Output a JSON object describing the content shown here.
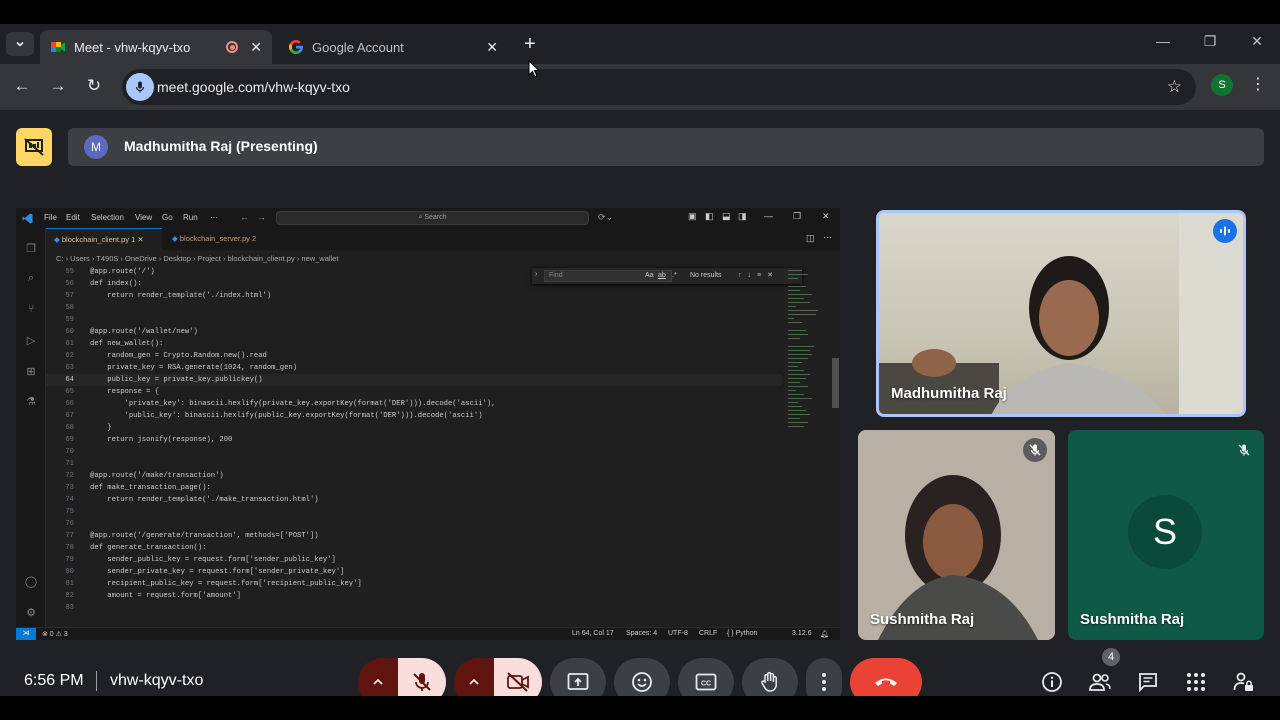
{
  "browser": {
    "tabs": [
      {
        "title": "Meet - vhw-kqyv-txo",
        "active": true
      },
      {
        "title": "Google Account",
        "active": false
      }
    ],
    "url": "meet.google.com/vhw-kqyv-txo",
    "profile_initial": "S"
  },
  "meet": {
    "presenter_initial": "M",
    "presenter_label": "Madhumitha Raj (Presenting)",
    "time": "6:56 PM",
    "meeting_code": "vhw-kqyv-txo",
    "participant_count": "4",
    "participants": [
      {
        "name": "Madhumitha Raj",
        "state": "speaking"
      },
      {
        "name": "Sushmitha Raj",
        "state": "muted"
      },
      {
        "name": "Sushmitha Raj",
        "state": "muted",
        "avatar_initial": "S"
      }
    ],
    "colors": {
      "hangup": "#ea4335",
      "muted_ctrl": "#f9dedc",
      "muted_ctrl_side": "#601410",
      "accent": "#a8c7fa"
    }
  },
  "vscode": {
    "menu": [
      "File",
      "Edit",
      "Selection",
      "View",
      "Go",
      "Run",
      "···"
    ],
    "search_placeholder": "Search",
    "tabs": [
      {
        "label": "blockchain_client.py 1"
      },
      {
        "label": "blockchain_server.py 2"
      }
    ],
    "breadcrumb": "C: › Users › T490S › OneDrive › Desktop › Project › blockchain_client.py › new_wallet",
    "find": {
      "placeholder": "Find",
      "aa": "Aa",
      "ab": "ab",
      "regex": ".*",
      "result": "No results"
    },
    "current_line": 64,
    "code": [
      {
        "n": "55",
        "t": "@app.route('/')"
      },
      {
        "n": "56",
        "t": "def index():"
      },
      {
        "n": "57",
        "t": "    return render_template('./index.html')"
      },
      {
        "n": "58",
        "t": ""
      },
      {
        "n": "59",
        "t": ""
      },
      {
        "n": "60",
        "t": "@app.route('/wallet/new')"
      },
      {
        "n": "61",
        "t": "def new_wallet():"
      },
      {
        "n": "62",
        "t": "    random_gen = Crypto.Random.new().read"
      },
      {
        "n": "63",
        "t": "    private_key = RSA.generate(1024, random_gen)"
      },
      {
        "n": "64",
        "t": "    public_key = private_key.publickey()"
      },
      {
        "n": "65",
        "t": "    response = {"
      },
      {
        "n": "66",
        "t": "        'private_key': binascii.hexlify(private_key.exportKey(format('DER'))).decode('ascii'),"
      },
      {
        "n": "67",
        "t": "        'public_key': binascii.hexlify(public_key.exportKey(format('DER'))).decode('ascii')"
      },
      {
        "n": "68",
        "t": "    }"
      },
      {
        "n": "69",
        "t": "    return jsonify(response), 200"
      },
      {
        "n": "70",
        "t": ""
      },
      {
        "n": "71",
        "t": ""
      },
      {
        "n": "72",
        "t": "@app.route('/make/transaction')"
      },
      {
        "n": "73",
        "t": "def make_transaction_page():"
      },
      {
        "n": "74",
        "t": "    return render_template('./make_transaction.html')"
      },
      {
        "n": "75",
        "t": ""
      },
      {
        "n": "76",
        "t": ""
      },
      {
        "n": "77",
        "t": "@app.route('/generate/transaction', methods=['POST'])"
      },
      {
        "n": "78",
        "t": "def generate_transaction():"
      },
      {
        "n": "79",
        "t": "    sender_public_key = request.form['sender_public_key']"
      },
      {
        "n": "80",
        "t": "    sender_private_key = request.form['sender_private_key']"
      },
      {
        "n": "81",
        "t": "    recipient_public_key = request.form['recipient_public_key']"
      },
      {
        "n": "82",
        "t": "    amount = request.form['amount']"
      },
      {
        "n": "83",
        "t": ""
      }
    ],
    "status": {
      "problems": "⊗ 0 ⚠ 3",
      "position": "Ln 64, Col 17",
      "spaces": "Spaces: 4",
      "encoding": "UTF-8",
      "eol": "CRLF",
      "language": "{ } Python",
      "version": "3.12.6"
    }
  }
}
